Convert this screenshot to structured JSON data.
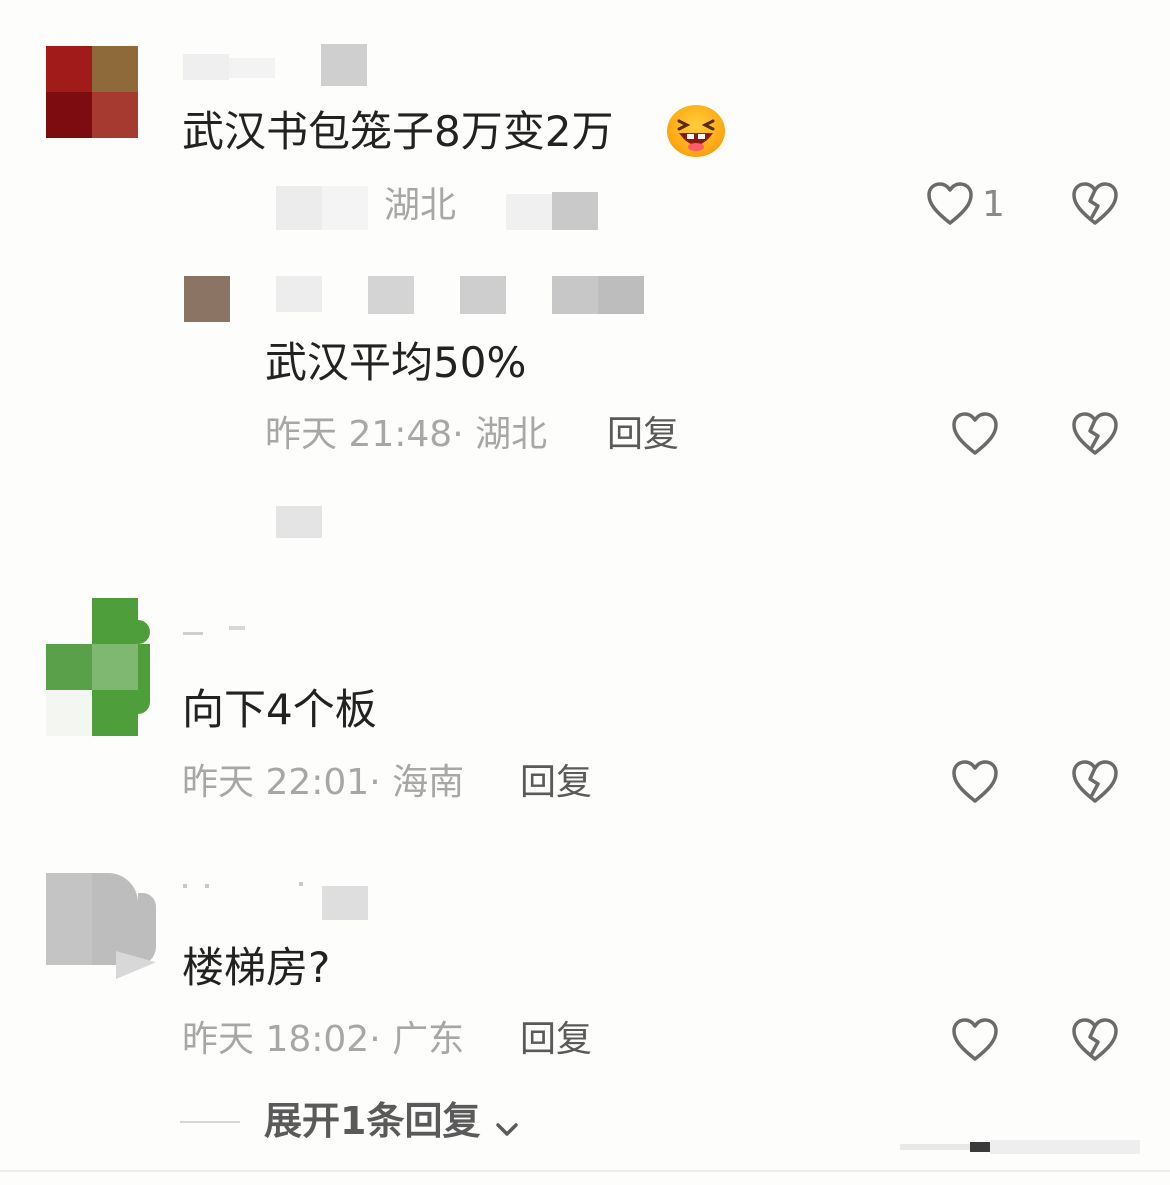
{
  "comments": [
    {
      "text": "武汉书包笼子8万变2万",
      "location": "湖北",
      "likes": "1"
    },
    {
      "text": "武汉平均50%",
      "time": "昨天 21:48",
      "location": "湖北",
      "reply_label": "回复"
    },
    {
      "text": "向下4个板",
      "time": "昨天 22:01",
      "location": "海南",
      "reply_label": "回复"
    },
    {
      "text": "楼梯房?",
      "time": "昨天 18:02",
      "location": "广东",
      "reply_label": "回复"
    }
  ],
  "expand": {
    "label": "展开1条回复"
  },
  "icons": {
    "like": "heart-outline-icon",
    "dislike": "broken-heart-icon",
    "expand": "chevron-down-icon"
  },
  "colors": {
    "background": "#fdfdfb",
    "text": "#222222",
    "meta": "#a7a7a7",
    "reply": "#5a5a5a",
    "icon": "#6b6b6b"
  }
}
